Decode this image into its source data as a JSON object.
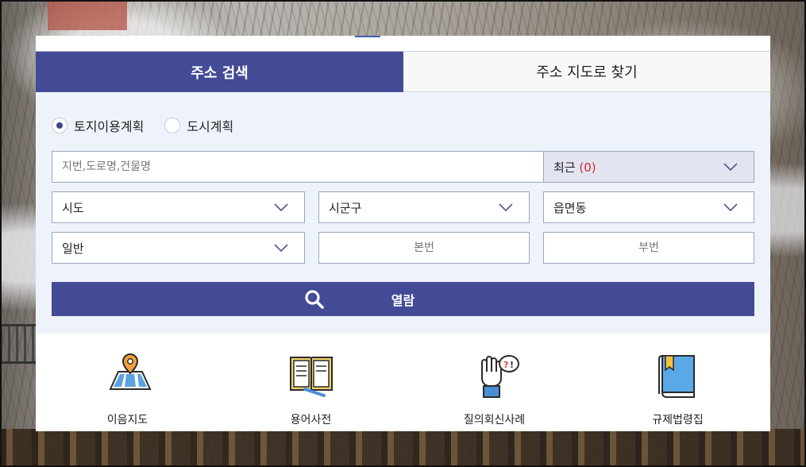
{
  "tabs": [
    {
      "label": "주소 검색",
      "active": true
    },
    {
      "label": "주소 지도로 찾기",
      "active": false
    }
  ],
  "radios": [
    {
      "label": "토지이용계획",
      "checked": true
    },
    {
      "label": "도시계획",
      "checked": false
    }
  ],
  "search": {
    "placeholder": "지번,도로명,건물명",
    "recent_label": "최근",
    "recent_count": "(0)"
  },
  "selects": {
    "sido": "시도",
    "sigungu": "시군구",
    "eupmyeondong": "읍면동",
    "type": "일반"
  },
  "inputs": {
    "bonbeon_placeholder": "본번",
    "bubeon_placeholder": "부번"
  },
  "view_button": {
    "label": "열람"
  },
  "quick_links": [
    {
      "label": "이음지도",
      "icon": "map-pin-icon"
    },
    {
      "label": "용어사전",
      "icon": "open-book-icon"
    },
    {
      "label": "질의회신사례",
      "icon": "question-hand-icon"
    },
    {
      "label": "규제법령집",
      "icon": "law-book-icon"
    }
  ],
  "colors": {
    "primary": "#434b96",
    "recent_bg": "#e3e4f2",
    "area_bg": "#eef3fb",
    "count": "#d62929"
  }
}
